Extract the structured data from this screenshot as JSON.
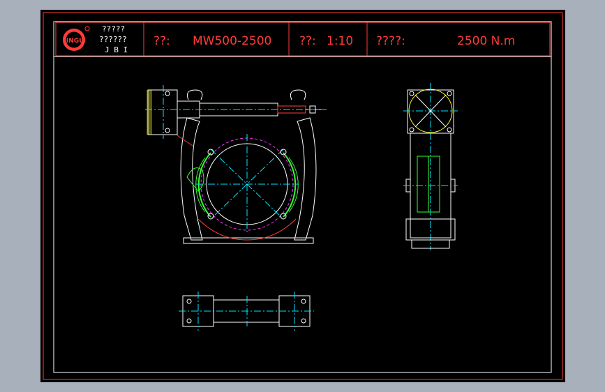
{
  "title_block": {
    "logo_text": "JINGU",
    "company_line1": "?????",
    "company_line2": "??????",
    "company_abbr": "J B I",
    "name_label": "??:",
    "model_value": "MW500-2500",
    "scale_label": "??:",
    "scale_value": "1:10",
    "torque_label": "????:",
    "torque_value": "2500 N.m"
  },
  "colors": {
    "background": "#a8b0bc",
    "canvas": "#000000",
    "frame": "#ffffff",
    "title_red": "#ff3b3b",
    "center_line": "#00e5ff",
    "brake_shoe": "#33ff33",
    "brake_drum": "#ff33ff",
    "highlight": "#ffff33"
  },
  "icons": {
    "logo": "jingu-logo-icon",
    "registered": "registered-mark-icon"
  }
}
